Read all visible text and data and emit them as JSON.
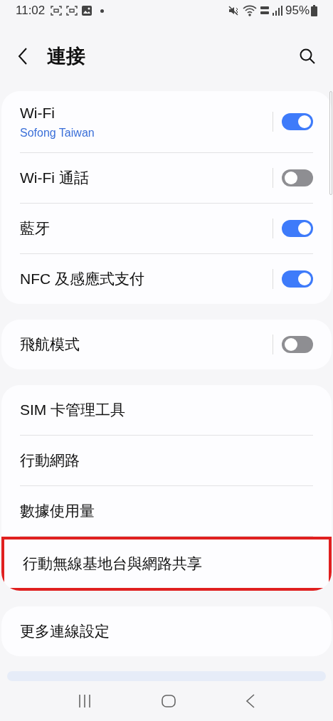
{
  "status_bar": {
    "time": "11:02",
    "battery": "95%"
  },
  "header": {
    "title": "連接"
  },
  "groups": [
    {
      "items": [
        {
          "kind": "toggle",
          "label": "Wi-Fi",
          "subtitle": "Sofong Taiwan",
          "on": true,
          "highlighted": false
        },
        {
          "kind": "toggle",
          "label": "Wi-Fi 通話",
          "on": false,
          "highlighted": false
        },
        {
          "kind": "toggle",
          "label": "藍牙",
          "on": true,
          "highlighted": false
        },
        {
          "kind": "toggle",
          "label": "NFC 及感應式支付",
          "on": true,
          "highlighted": false
        }
      ]
    },
    {
      "items": [
        {
          "kind": "toggle",
          "label": "飛航模式",
          "on": false,
          "highlighted": false
        }
      ]
    },
    {
      "items": [
        {
          "kind": "link",
          "label": "SIM 卡管理工具",
          "highlighted": false
        },
        {
          "kind": "link",
          "label": "行動網路",
          "highlighted": false
        },
        {
          "kind": "link",
          "label": "數據使用量",
          "highlighted": false
        },
        {
          "kind": "link",
          "label": "行動無線基地台與網路共享",
          "highlighted": true
        }
      ]
    },
    {
      "items": [
        {
          "kind": "link",
          "label": "更多連線設定",
          "highlighted": false
        }
      ]
    }
  ]
}
